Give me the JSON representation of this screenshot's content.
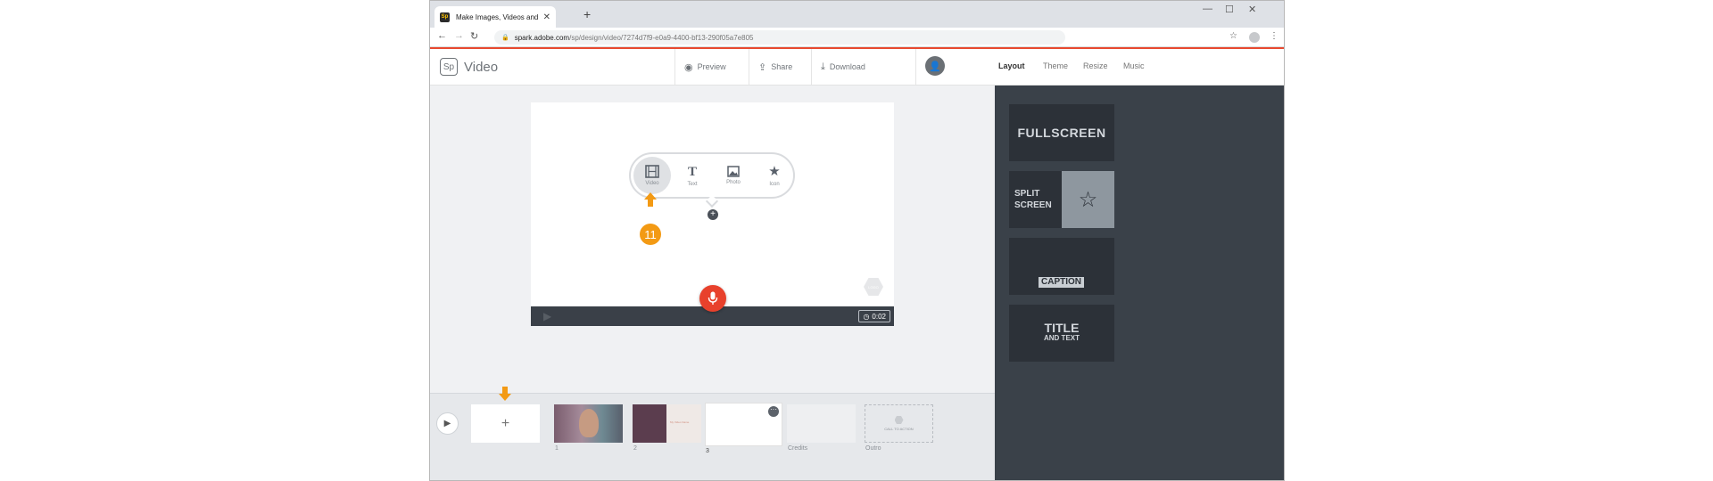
{
  "browser": {
    "tab_title": "Make Images, Videos and Web S",
    "tab_favicon": "Sp",
    "url_host": "spark.adobe.com",
    "url_path": "/sp/design/video/7274d7f9-e0a9-4400-bf13-290f05a7e805"
  },
  "app": {
    "logo_text": "Sp",
    "name": "Video",
    "toolbar": {
      "preview": "Preview",
      "share": "Share",
      "download": "Download"
    },
    "right_tabs": [
      "Layout",
      "Theme",
      "Resize",
      "Music"
    ],
    "active_tab": "Layout",
    "accent_color": "#e8492f"
  },
  "canvas": {
    "add_options": [
      {
        "label": "Video",
        "icon": "film-icon"
      },
      {
        "label": "Text",
        "icon": "text-icon"
      },
      {
        "label": "Photo",
        "icon": "image-icon"
      },
      {
        "label": "Icon",
        "icon": "star-icon"
      }
    ],
    "step_number": "11",
    "duration": "0:02",
    "watermark": "LOGO"
  },
  "timeline": {
    "items": [
      {
        "label": "1"
      },
      {
        "label": "2"
      },
      {
        "label": "3"
      },
      {
        "label": "Credits"
      },
      {
        "label": "Outro"
      }
    ],
    "slide2_text": "My Video Name",
    "outro_text": "CALL TO ACTION"
  },
  "layouts": {
    "fullscreen": "FULLSCREEN",
    "split_line1": "SPLIT",
    "split_line2": "SCREEN",
    "caption": "CAPTION",
    "title_big": "TITLE",
    "title_small": "AND TEXT"
  }
}
